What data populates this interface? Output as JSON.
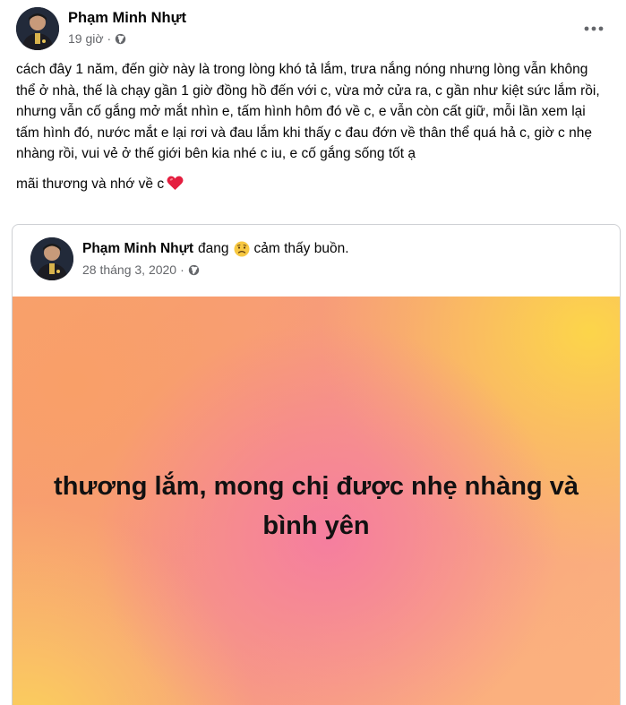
{
  "post": {
    "author": "Phạm Minh Nhựt",
    "timestamp": "19 giờ",
    "privacy_icon": "globe-icon",
    "more_icon": "more-options-icon",
    "text_paragraph_1": "cách đây 1 năm, đến giờ này là trong lòng khó tả lắm, trưa nắng nóng nhưng lòng vẫn không thể ở nhà, thế là chạy gần 1 giờ đồng hồ đến với c, vừa mở cửa ra, c gần như kiệt sức lắm rồi, nhưng vẫn cố gắng mở mắt nhìn e, tấm hình hôm đó về c, e vẫn còn cất giữ, mỗi lần xem lại tấm hình đó, nước mắt e lại rơi và đau lắm khi thấy c đau đớn về thân thể quá hả c, giờ c nhẹ nhàng rồi, vui vẻ ở thế giới bên kia nhé c iu, e cố gắng sống tốt ạ",
    "text_paragraph_2": "mãi thương và nhớ về c",
    "heart_color": "#e41e3f"
  },
  "shared_post": {
    "author": "Phạm Minh Nhựt",
    "feeling_prefix": "đang",
    "feeling_icon": "sad-face-icon",
    "feeling_text": "cảm thấy buồn.",
    "timestamp": "28 tháng 3, 2020",
    "privacy_icon": "globe-icon",
    "background_text": "thương lắm, mong chị được nhẹ nhàng và bình yên",
    "background_colors": [
      "#f57e9f",
      "#fcd54a",
      "#f99f68",
      "#fbb07e"
    ]
  }
}
